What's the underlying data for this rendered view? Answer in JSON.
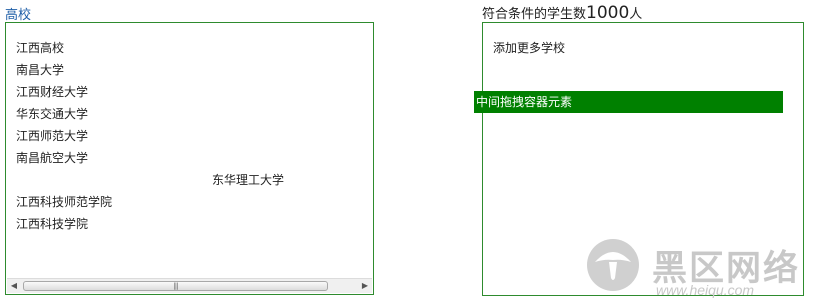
{
  "left_panel": {
    "title": "高校",
    "schools": [
      {
        "label": "江西高校"
      },
      {
        "label": "南昌大学"
      },
      {
        "label": "江西财经大学"
      },
      {
        "label": "华东交通大学"
      },
      {
        "label": "江西师范大学"
      },
      {
        "label": "南昌航空大学"
      },
      {
        "label": ""
      },
      {
        "label": "江西科技师范学院"
      },
      {
        "label": "江西科技学院"
      }
    ],
    "offset_item_label": "东华理工大学",
    "scrollbar": {
      "left_arrow": "◀",
      "right_arrow": "▶",
      "thumb_grip": "|||"
    }
  },
  "right_panel": {
    "title_prefix": "符合条件的学生数",
    "count": "1000",
    "title_suffix": "人",
    "add_more_label": "添加更多学校"
  },
  "drag_element": {
    "label": "中间拖拽容器元素",
    "color": "#008000"
  },
  "watermark": {
    "text": "黑区网络",
    "url": "www.heiqu.com"
  },
  "colors": {
    "panel_border": "#2e8b2e",
    "left_title": "#1f5fa8"
  }
}
